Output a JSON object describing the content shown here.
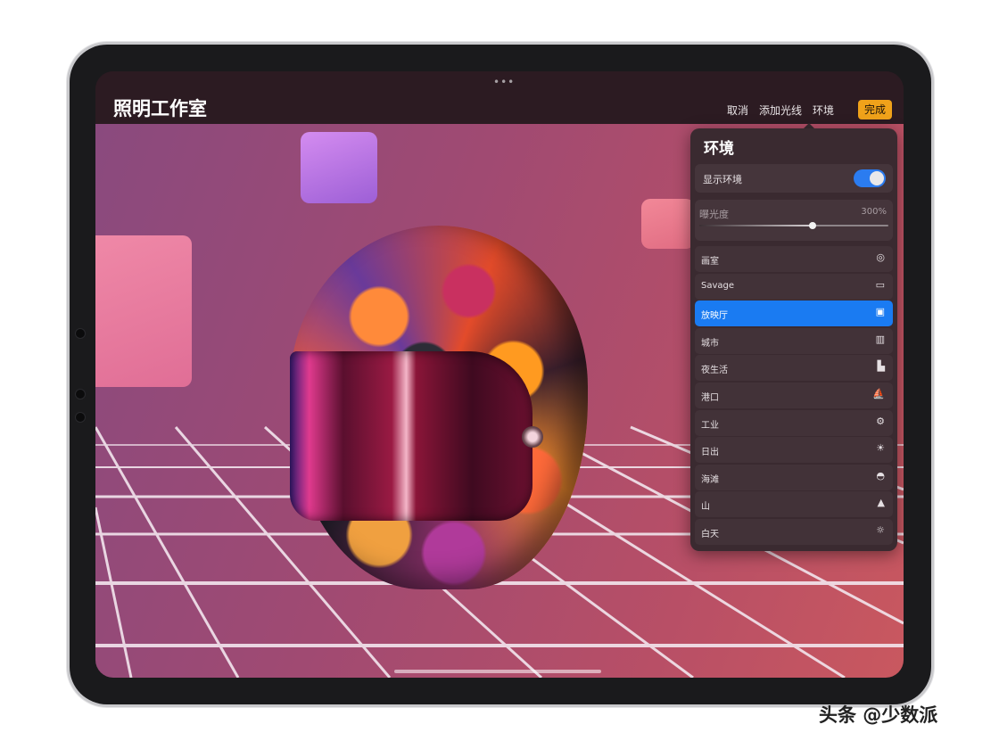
{
  "app": {
    "title": "照明工作室"
  },
  "topbar": {
    "cancel_label": "取消",
    "add_light_label": "添加光线",
    "environment_label": "环境",
    "done_label": "完成"
  },
  "panel": {
    "title": "环境",
    "show_environment": {
      "label": "显示环境",
      "on": true
    },
    "exposure": {
      "label": "曝光度",
      "value_text": "300%",
      "level": 0.6
    },
    "items": [
      {
        "label": "画室",
        "icon": "lifebuoy-icon",
        "glyph": "◎",
        "selected": false
      },
      {
        "label": "Savage",
        "icon": "monitor-icon",
        "glyph": "▭",
        "selected": false
      },
      {
        "label": "放映厅",
        "icon": "screening-room-icon",
        "glyph": "▣",
        "selected": true
      },
      {
        "label": "城市",
        "icon": "city-icon",
        "glyph": "▥",
        "selected": false
      },
      {
        "label": "夜生活",
        "icon": "nightlife-icon",
        "glyph": "▙",
        "selected": false
      },
      {
        "label": "港口",
        "icon": "sailboat-icon",
        "glyph": "⛵",
        "selected": false
      },
      {
        "label": "工业",
        "icon": "gears-icon",
        "glyph": "⚙",
        "selected": false
      },
      {
        "label": "日出",
        "icon": "sunrise-icon",
        "glyph": "☀",
        "selected": false
      },
      {
        "label": "海滩",
        "icon": "shell-icon",
        "glyph": "◓",
        "selected": false
      },
      {
        "label": "山",
        "icon": "mountain-icon",
        "glyph": "▲",
        "selected": false
      },
      {
        "label": "白天",
        "icon": "sun-icon",
        "glyph": "☼",
        "selected": false
      }
    ]
  },
  "watermark": "头条 @少数派",
  "colors": {
    "accent": "#1a7bf2",
    "done_button": "#f0a21a",
    "toggle_on": "#2b7cf0"
  }
}
